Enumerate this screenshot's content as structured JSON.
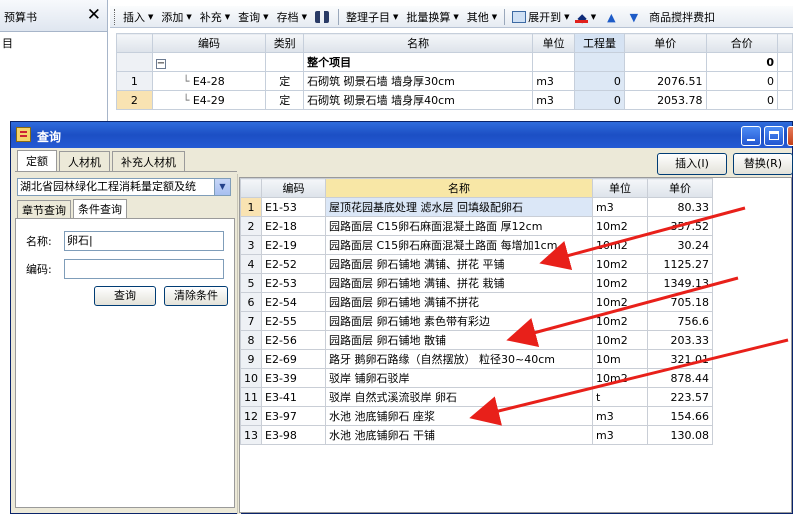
{
  "left_pane": {
    "title": "预算书",
    "close_label": "✕",
    "tree_root": "目"
  },
  "toolbar": {
    "items": [
      {
        "label": "插入",
        "dropdown": true
      },
      {
        "label": "添加",
        "dropdown": true
      },
      {
        "label": "补充",
        "dropdown": true
      },
      {
        "label": "查询",
        "dropdown": true
      },
      {
        "label": "存档",
        "dropdown": true
      },
      {
        "label": "整理子目",
        "dropdown": true
      },
      {
        "label": "批量换算",
        "dropdown": true
      },
      {
        "label": "其他",
        "dropdown": true
      },
      {
        "label": "展开到",
        "dropdown": true
      },
      {
        "label": "商品搅拌费扣"
      }
    ]
  },
  "budget_grid": {
    "headers": [
      "编码",
      "类别",
      "名称",
      "单位",
      "工程量",
      "单价",
      "合价"
    ],
    "section_row": {
      "name": "整个项目",
      "total": "0"
    },
    "rows": [
      {
        "num": "1",
        "code": "E4-28",
        "type": "定",
        "name": "石砌筑 砌景石墙 墙身厚30cm",
        "unit": "m3",
        "qty": "0",
        "price": "2076.51",
        "total": "0"
      },
      {
        "num": "2",
        "code": "E4-29",
        "type": "定",
        "name": "石砌筑 砌景石墙 墙身厚40cm",
        "unit": "m3",
        "qty": "0",
        "price": "2053.78",
        "total": "0"
      }
    ]
  },
  "dialog": {
    "title": "查询",
    "tabs": [
      "定额",
      "人材机",
      "补充人材机"
    ],
    "insert_button": "插入(I)",
    "replace_button": "替换(R)",
    "library": "湖北省园林绿化工程消耗量定额及统",
    "query_tabs": [
      "章节查询",
      "条件查询"
    ],
    "name_label": "名称:",
    "name_value": "卵石|",
    "code_label": "编码:",
    "code_value": "",
    "search_button": "查询",
    "clear_button": "清除条件",
    "results": {
      "headers": [
        "编码",
        "名称",
        "单位",
        "单价"
      ],
      "rows": [
        {
          "num": "1",
          "code": "E1-53",
          "name": "屋顶花园基底处理 滤水层 回填级配卵石",
          "unit": "m3",
          "price": "80.33"
        },
        {
          "num": "2",
          "code": "E2-18",
          "name": "园路面层 C15卵石麻面混凝土路面 厚12cm",
          "unit": "10m2",
          "price": "357.52"
        },
        {
          "num": "3",
          "code": "E2-19",
          "name": "园路面层 C15卵石麻面混凝土路面 每增加1cm",
          "unit": "10m2",
          "price": "30.24"
        },
        {
          "num": "4",
          "code": "E2-52",
          "name": "园路面层 卵石铺地 满铺、拼花 平铺",
          "unit": "10m2",
          "price": "1125.27"
        },
        {
          "num": "5",
          "code": "E2-53",
          "name": "园路面层 卵石铺地 满铺、拼花 栽铺",
          "unit": "10m2",
          "price": "1349.13"
        },
        {
          "num": "6",
          "code": "E2-54",
          "name": "园路面层 卵石铺地 满铺不拼花",
          "unit": "10m2",
          "price": "705.18"
        },
        {
          "num": "7",
          "code": "E2-55",
          "name": "园路面层 卵石铺地 素色带有彩边",
          "unit": "10m2",
          "price": "756.6"
        },
        {
          "num": "8",
          "code": "E2-56",
          "name": "园路面层 卵石铺地 散铺",
          "unit": "10m2",
          "price": "203.33"
        },
        {
          "num": "9",
          "code": "E2-69",
          "name": "路牙 鹅卵石路缘（自然摆放） 粒径30~40cm",
          "unit": "10m",
          "price": "321.01"
        },
        {
          "num": "10",
          "code": "E3-39",
          "name": "驳岸 铺卵石驳岸",
          "unit": "10m2",
          "price": "878.44"
        },
        {
          "num": "11",
          "code": "E3-41",
          "name": "驳岸 自然式溪流驳岸 卵石",
          "unit": "t",
          "price": "223.57"
        },
        {
          "num": "12",
          "code": "E3-97",
          "name": "水池 池底铺卵石 座浆",
          "unit": "m3",
          "price": "154.66"
        },
        {
          "num": "13",
          "code": "E3-98",
          "name": "水池 池底铺卵石 干铺",
          "unit": "m3",
          "price": "130.08"
        }
      ]
    }
  },
  "colors": {
    "title_bar": "#245ad4",
    "selection": "#f9e3b2",
    "annotation_arrow": "#e8201a"
  }
}
